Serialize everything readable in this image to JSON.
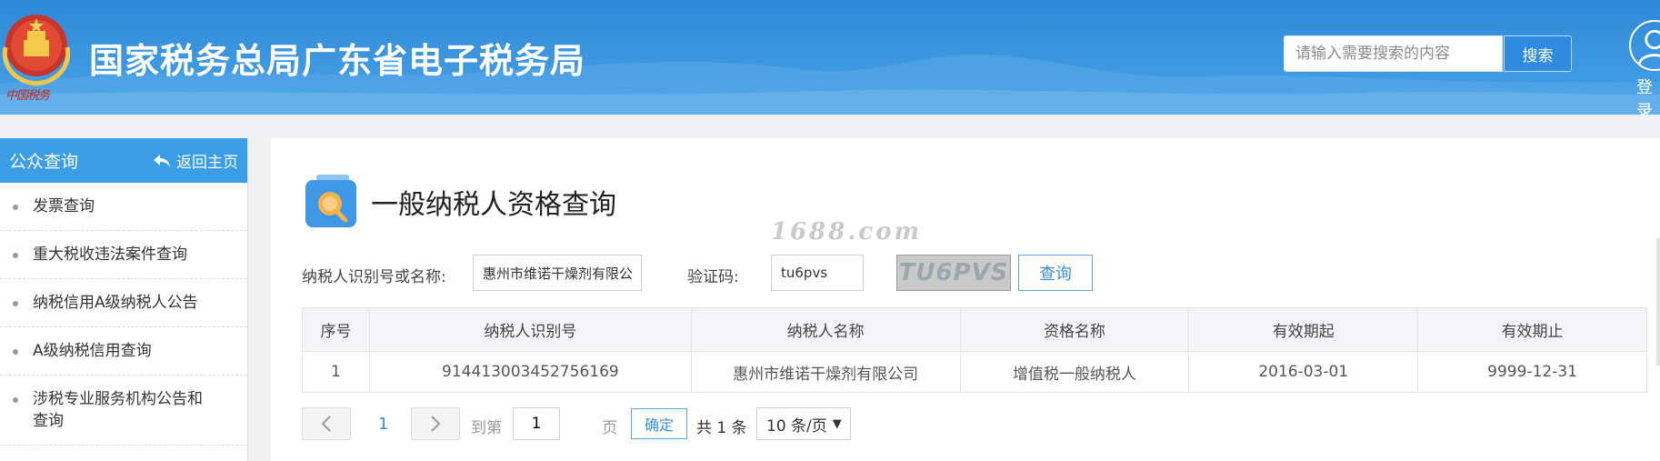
{
  "header": {
    "site_title": "国家税务总局广东省电子税务局",
    "emblem_text": "中国税务",
    "search_placeholder": "请输入需要搜索的内容",
    "search_button": "搜索",
    "login_label": "登录"
  },
  "sidebar": {
    "title": "公众查询",
    "back_label": "返回主页",
    "items": [
      {
        "label": "发票查询"
      },
      {
        "label": "重大税收违法案件查询"
      },
      {
        "label": "纳税信用A级纳税人公告"
      },
      {
        "label": "A级纳税信用查询"
      },
      {
        "label": "涉税专业服务机构公告和查询"
      }
    ]
  },
  "main": {
    "page_title": "一般纳税人资格查询",
    "watermark": "1688.com",
    "form": {
      "taxpayer_label": "纳税人识别号或名称:",
      "taxpayer_value": "惠州市维诺干燥剂有限公司",
      "captcha_label": "验证码:",
      "captcha_value": "tu6pvs",
      "captcha_image_text": "TU6PVS",
      "query_button": "查询"
    },
    "table": {
      "headers": [
        "序号",
        "纳税人识别号",
        "纳税人名称",
        "资格名称",
        "有效期起",
        "有效期止"
      ],
      "rows": [
        [
          "1",
          "914413003452756169",
          "惠州市维诺干燥剂有限公司",
          "增值税一般纳税人",
          "2016-03-01",
          "9999-12-31"
        ]
      ]
    },
    "pager": {
      "current_page": "1",
      "goto_label": "到第",
      "goto_value": "1",
      "page_suffix": "页",
      "confirm_label": "确定",
      "total_text": "共 1 条",
      "page_size": "10 条/页"
    }
  },
  "colors": {
    "header_blue": "#3d97e0",
    "sidebar_head": "#3a9de6",
    "link_blue": "#3a8fd9"
  }
}
